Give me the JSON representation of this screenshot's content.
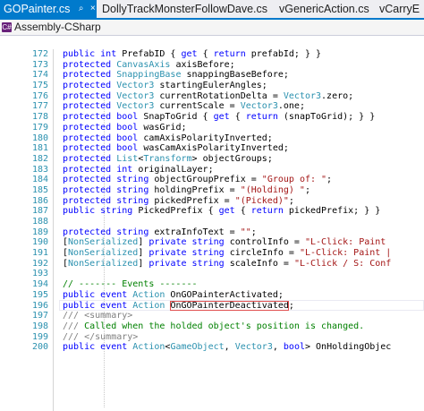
{
  "tabs": [
    {
      "label": "GOPainter.cs",
      "icons": [
        "⌕",
        "×"
      ]
    },
    {
      "label": "DollyTrackMonsterFollowDave.cs"
    },
    {
      "label": "vGenericAction.cs"
    },
    {
      "label": "vCarryE"
    }
  ],
  "navbar": {
    "project": "Assembly-CSharp",
    "project_icon": "C#"
  },
  "colors": {
    "keyword": "#0000ff",
    "type": "#2b91af",
    "string": "#a31515",
    "comment": "#008000",
    "line_number": "#2b91af",
    "active_tab": "#007acc"
  },
  "code_lines": [
    {
      "n": "172",
      "tokens": [
        [
          "kw",
          "public "
        ],
        [
          "kw",
          "int "
        ],
        [
          "tx",
          "PrefabID { "
        ],
        [
          "kw",
          "get"
        ],
        [
          "tx",
          " { "
        ],
        [
          "kw",
          "return "
        ],
        [
          "tx",
          "prefabId; } }"
        ]
      ]
    },
    {
      "n": "173",
      "tokens": [
        [
          "kw",
          "protected "
        ],
        [
          "ty",
          "CanvasAxis"
        ],
        [
          "tx",
          " axisBefore;"
        ]
      ]
    },
    {
      "n": "174",
      "tokens": [
        [
          "kw",
          "protected "
        ],
        [
          "ty",
          "SnappingBase"
        ],
        [
          "tx",
          " snappingBaseBefore;"
        ]
      ]
    },
    {
      "n": "175",
      "tokens": [
        [
          "kw",
          "protected "
        ],
        [
          "ty",
          "Vector3"
        ],
        [
          "tx",
          " startingEulerAngles;"
        ]
      ]
    },
    {
      "n": "176",
      "tokens": [
        [
          "kw",
          "protected "
        ],
        [
          "ty",
          "Vector3"
        ],
        [
          "tx",
          " currentRotationDelta = "
        ],
        [
          "ty",
          "Vector3"
        ],
        [
          "tx",
          ".zero;"
        ]
      ]
    },
    {
      "n": "177",
      "tokens": [
        [
          "kw",
          "protected "
        ],
        [
          "ty",
          "Vector3"
        ],
        [
          "tx",
          " currentScale = "
        ],
        [
          "ty",
          "Vector3"
        ],
        [
          "tx",
          ".one;"
        ]
      ]
    },
    {
      "n": "178",
      "tokens": [
        [
          "kw",
          "protected "
        ],
        [
          "kw",
          "bool "
        ],
        [
          "tx",
          "SnapToGrid { "
        ],
        [
          "kw",
          "get"
        ],
        [
          "tx",
          " { "
        ],
        [
          "kw",
          "return "
        ],
        [
          "tx",
          "(snapToGrid); } }"
        ]
      ]
    },
    {
      "n": "179",
      "tokens": [
        [
          "kw",
          "protected "
        ],
        [
          "kw",
          "bool "
        ],
        [
          "tx",
          "wasGrid;"
        ]
      ]
    },
    {
      "n": "180",
      "tokens": [
        [
          "kw",
          "protected "
        ],
        [
          "kw",
          "bool "
        ],
        [
          "tx",
          "camAxisPolarityInverted;"
        ]
      ]
    },
    {
      "n": "181",
      "tokens": [
        [
          "kw",
          "protected "
        ],
        [
          "kw",
          "bool "
        ],
        [
          "tx",
          "wasCamAxisPolarityInverted;"
        ]
      ]
    },
    {
      "n": "182",
      "tokens": [
        [
          "kw",
          "protected "
        ],
        [
          "ty",
          "List"
        ],
        [
          "tx",
          "<"
        ],
        [
          "ty",
          "Transform"
        ],
        [
          "tx",
          "> objectGroups;"
        ]
      ]
    },
    {
      "n": "183",
      "tokens": [
        [
          "kw",
          "protected "
        ],
        [
          "kw",
          "int "
        ],
        [
          "tx",
          "originalLayer;"
        ]
      ]
    },
    {
      "n": "184",
      "tokens": [
        [
          "kw",
          "protected "
        ],
        [
          "kw",
          "string "
        ],
        [
          "tx",
          "objectGroupPrefix = "
        ],
        [
          "st",
          "\"Group of: \""
        ],
        [
          "tx",
          ";"
        ]
      ]
    },
    {
      "n": "185",
      "tokens": [
        [
          "kw",
          "protected "
        ],
        [
          "kw",
          "string "
        ],
        [
          "tx",
          "holdingPrefix = "
        ],
        [
          "st",
          "\"(Holding) \""
        ],
        [
          "tx",
          ";"
        ]
      ]
    },
    {
      "n": "186",
      "tokens": [
        [
          "kw",
          "protected "
        ],
        [
          "kw",
          "string "
        ],
        [
          "tx",
          "pickedPrefix = "
        ],
        [
          "st",
          "\"(Picked)\""
        ],
        [
          "tx",
          ";"
        ]
      ]
    },
    {
      "n": "187",
      "tokens": [
        [
          "kw",
          "public "
        ],
        [
          "kw",
          "string "
        ],
        [
          "tx",
          "PickedPrefix { "
        ],
        [
          "kw",
          "get"
        ],
        [
          "tx",
          " { "
        ],
        [
          "kw",
          "return "
        ],
        [
          "tx",
          "pickedPrefix; } }"
        ]
      ]
    },
    {
      "n": "188",
      "tokens": []
    },
    {
      "n": "189",
      "tokens": [
        [
          "kw",
          "protected "
        ],
        [
          "kw",
          "string "
        ],
        [
          "tx",
          "extraInfoText = "
        ],
        [
          "st",
          "\"\""
        ],
        [
          "tx",
          ";"
        ]
      ]
    },
    {
      "n": "190",
      "tokens": [
        [
          "tx",
          "["
        ],
        [
          "ty",
          "NonSerialized"
        ],
        [
          "tx",
          "] "
        ],
        [
          "kw",
          "private "
        ],
        [
          "kw",
          "string "
        ],
        [
          "tx",
          "controlInfo = "
        ],
        [
          "st",
          "\"L-Click: Paint "
        ]
      ]
    },
    {
      "n": "191",
      "tokens": [
        [
          "tx",
          "["
        ],
        [
          "ty",
          "NonSerialized"
        ],
        [
          "tx",
          "] "
        ],
        [
          "kw",
          "private "
        ],
        [
          "kw",
          "string "
        ],
        [
          "tx",
          "circleInfo = "
        ],
        [
          "st",
          "\"L-Click: Paint |"
        ]
      ]
    },
    {
      "n": "192",
      "tokens": [
        [
          "tx",
          "["
        ],
        [
          "ty",
          "NonSerialized"
        ],
        [
          "tx",
          "] "
        ],
        [
          "kw",
          "private "
        ],
        [
          "kw",
          "string "
        ],
        [
          "tx",
          "scaleInfo = "
        ],
        [
          "st",
          "\"L-Click / S: Conf"
        ]
      ]
    },
    {
      "n": "193",
      "tokens": []
    },
    {
      "n": "194",
      "tokens": [
        [
          "cm",
          "// ------- Events -------"
        ]
      ]
    },
    {
      "n": "195",
      "tokens": [
        [
          "kw",
          "public "
        ],
        [
          "kw",
          "event "
        ],
        [
          "ty",
          "Action"
        ],
        [
          "tx",
          " OnGOPainterActivated;"
        ]
      ]
    },
    {
      "n": "196",
      "tokens": [
        [
          "kw",
          "public "
        ],
        [
          "kw",
          "event "
        ],
        [
          "ty",
          "Action"
        ],
        [
          "tx",
          " "
        ],
        [
          "sel",
          "OnGOPainterDeactivated"
        ],
        [
          "tx",
          ";"
        ]
      ],
      "current": true
    },
    {
      "n": "197",
      "tokens": [
        [
          "dc",
          "/// "
        ],
        [
          "dc",
          "<summary>"
        ]
      ]
    },
    {
      "n": "198",
      "tokens": [
        [
          "dc",
          "/// "
        ],
        [
          "cm",
          "Called when the holded object's position is changed."
        ]
      ]
    },
    {
      "n": "199",
      "tokens": [
        [
          "dc",
          "/// "
        ],
        [
          "dc",
          "</summary>"
        ]
      ]
    },
    {
      "n": "200",
      "tokens": [
        [
          "kw",
          "public "
        ],
        [
          "kw",
          "event "
        ],
        [
          "ty",
          "Action"
        ],
        [
          "tx",
          "<"
        ],
        [
          "ty",
          "GameObject"
        ],
        [
          "tx",
          ", "
        ],
        [
          "ty",
          "Vector3"
        ],
        [
          "tx",
          ", "
        ],
        [
          "kw",
          "bool"
        ],
        [
          "tx",
          "> OnHoldingObjec"
        ]
      ]
    }
  ]
}
